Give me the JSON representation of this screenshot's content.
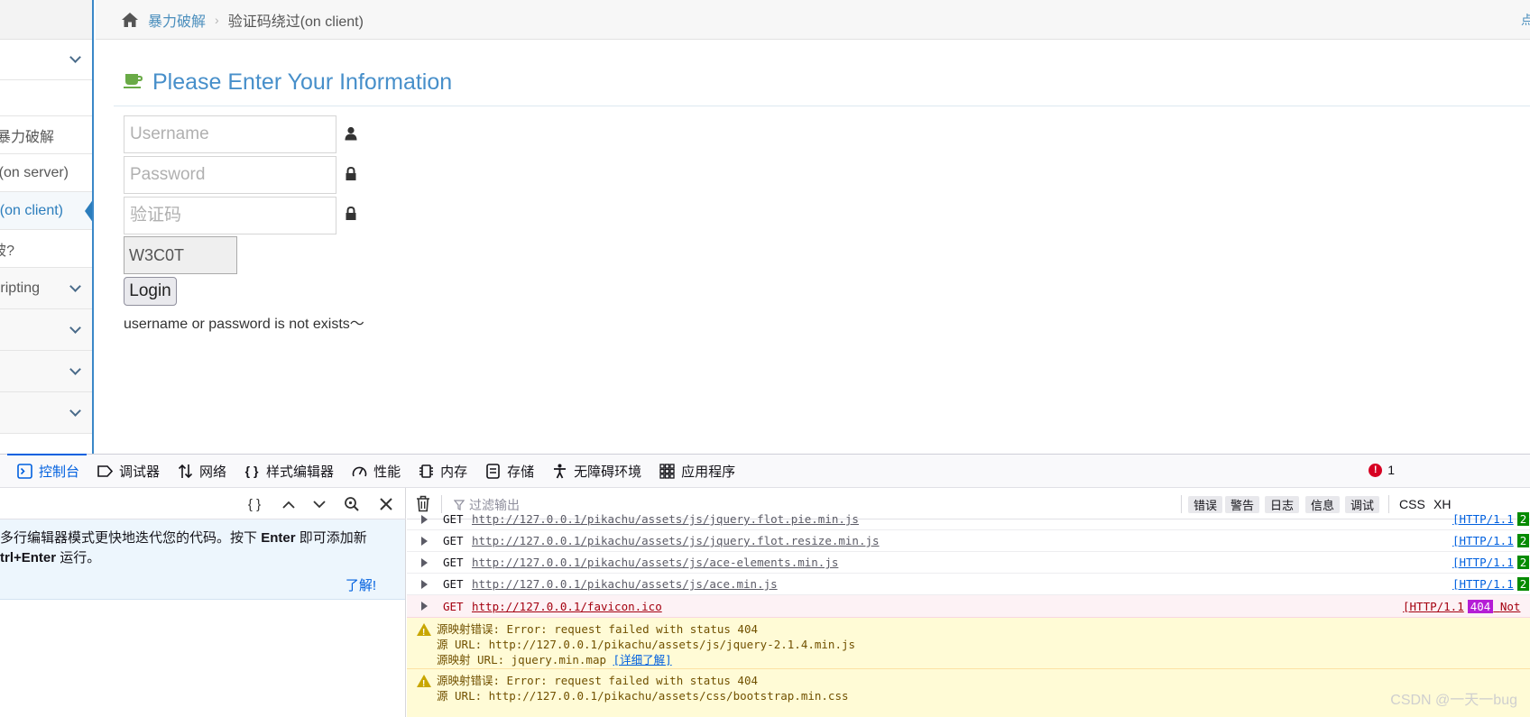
{
  "breadcrumb": {
    "home_link": "暴力破解",
    "current": "验证码绕过(on client)",
    "top_right": "点"
  },
  "sidebar": {
    "items": [
      {
        "label": ""
      },
      {
        "label": ""
      },
      {
        "label": "基于表单的暴力破解"
      },
      {
        "label": "验证码绕过(on server)"
      },
      {
        "label": "验证码绕过(on client)"
      },
      {
        "label": "token防爆破?"
      },
      {
        "label": "Cross-Site Scripting"
      }
    ],
    "visible_labels": [
      "单暴力破解",
      "(on server)",
      "(on client)",
      "破?",
      "ripting"
    ]
  },
  "form": {
    "title": "Please Enter Your Information",
    "username_placeholder": "Username",
    "password_placeholder": "Password",
    "vcode_placeholder": "验证码",
    "vcode_value": "W3C0T",
    "login_label": "Login",
    "message": "username or password is not exists～"
  },
  "devtools": {
    "tabs": [
      {
        "label": "控制台",
        "icon": "console-icon",
        "active": true
      },
      {
        "label": "调试器",
        "icon": "debugger-icon"
      },
      {
        "label": "网络",
        "icon": "network-icon"
      },
      {
        "label": "样式编辑器",
        "icon": "style-editor-icon"
      },
      {
        "label": "性能",
        "icon": "performance-icon"
      },
      {
        "label": "内存",
        "icon": "memory-icon"
      },
      {
        "label": "存储",
        "icon": "storage-icon"
      },
      {
        "label": "无障碍环境",
        "icon": "accessibility-icon"
      },
      {
        "label": "应用程序",
        "icon": "application-icon"
      }
    ],
    "error_count": "1",
    "tip_line1": "多行编辑器模式更快地迭代您的代码。按下",
    "tip_enter": "Enter",
    "tip_line1_end": "即可添加新",
    "tip_ctrl_enter": "trl+Enter",
    "tip_line2_end": "运行。",
    "tip_learn": "了解!",
    "filter_placeholder": "过滤输出",
    "levels": [
      "错误",
      "警告",
      "日志",
      "信息",
      "调试"
    ],
    "extra_filters": [
      "CSS",
      "XH"
    ],
    "log_rows": [
      {
        "method": "GET",
        "url": "http://127.0.0.1/pikachu/assets/js/jquery.flot.pie.min.js",
        "proto": "[HTTP/1.1",
        "status": "2"
      },
      {
        "method": "GET",
        "url": "http://127.0.0.1/pikachu/assets/js/jquery.flot.resize.min.js",
        "proto": "[HTTP/1.1",
        "status": "2"
      },
      {
        "method": "GET",
        "url": "http://127.0.0.1/pikachu/assets/js/ace-elements.min.js",
        "proto": "[HTTP/1.1",
        "status": "2"
      },
      {
        "method": "GET",
        "url": "http://127.0.0.1/pikachu/assets/js/ace.min.js",
        "proto": "[HTTP/1.1",
        "status": "2"
      }
    ],
    "error_row": {
      "method": "GET",
      "url": "http://127.0.0.1/favicon.ico",
      "proto": "[HTTP/1.1",
      "status": "404",
      "status_text": "Not"
    },
    "warnings": [
      {
        "line1": "源映射错误: Error: request failed with status 404",
        "line2": "源 URL: http://127.0.0.1/pikachu/assets/js/jquery-2.1.4.min.js",
        "line3": "源映射 URL: jquery.min.map",
        "link": "[详细了解]"
      },
      {
        "line1": "源映射错误: Error: request failed with status 404",
        "line2": "源 URL: http://127.0.0.1/pikachu/assets/css/bootstrap.min.css"
      }
    ]
  },
  "watermark": "CSDN @一天一bug",
  "colors": {
    "accent": "#478fca",
    "devtools_blue": "#0060df",
    "warning_bg": "#fffbd6",
    "error_bg": "#fdf2f5"
  }
}
